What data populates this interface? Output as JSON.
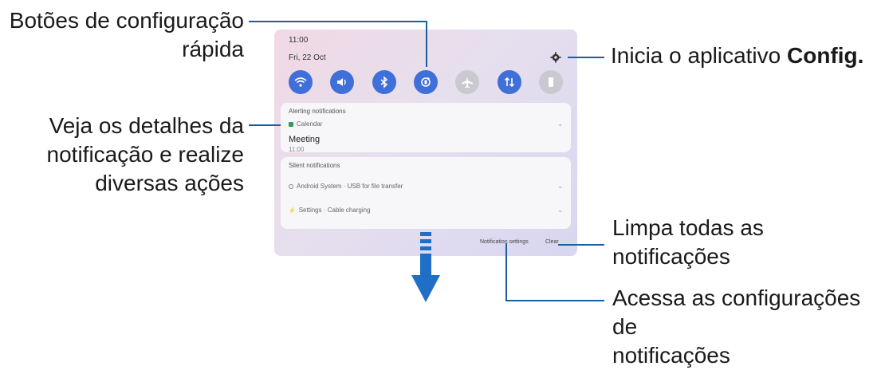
{
  "callouts": {
    "quick_buttons": [
      "Botões de configuração",
      "rápida"
    ],
    "settings_app": {
      "prefix": "Inicia o aplicativo ",
      "bold": "Config."
    },
    "notif_details": [
      "Veja os detalhes da",
      "notificação e realize",
      "diversas ações"
    ],
    "clear_all": [
      "Limpa todas as",
      "notificações"
    ],
    "notif_settings": [
      "Acessa as configurações de",
      "notificações"
    ]
  },
  "screen": {
    "time": "11:00",
    "date": "Fri, 22 Oct",
    "quick_settings": [
      {
        "name": "wifi",
        "state": "on"
      },
      {
        "name": "sound",
        "state": "on"
      },
      {
        "name": "bluetooth",
        "state": "on"
      },
      {
        "name": "auto-rotate",
        "state": "on"
      },
      {
        "name": "airplane",
        "state": "off"
      },
      {
        "name": "mobile-data",
        "state": "on"
      },
      {
        "name": "flashlight",
        "state": "off"
      }
    ],
    "alerting": {
      "header": "Alerting notifications",
      "app": "Calendar",
      "title": "Meeting",
      "time": "11:00"
    },
    "silent": {
      "header": "Silent notifications",
      "item1": "Android System · USB for file transfer",
      "item2": "Settings · Cable charging"
    },
    "footer": {
      "settings_label": "Notification settings",
      "clear_label": "Clear"
    }
  },
  "colors": {
    "accent": "#3f6fd8",
    "leader_line": "#1f5e9e",
    "arrow": "#1f6fc6"
  }
}
